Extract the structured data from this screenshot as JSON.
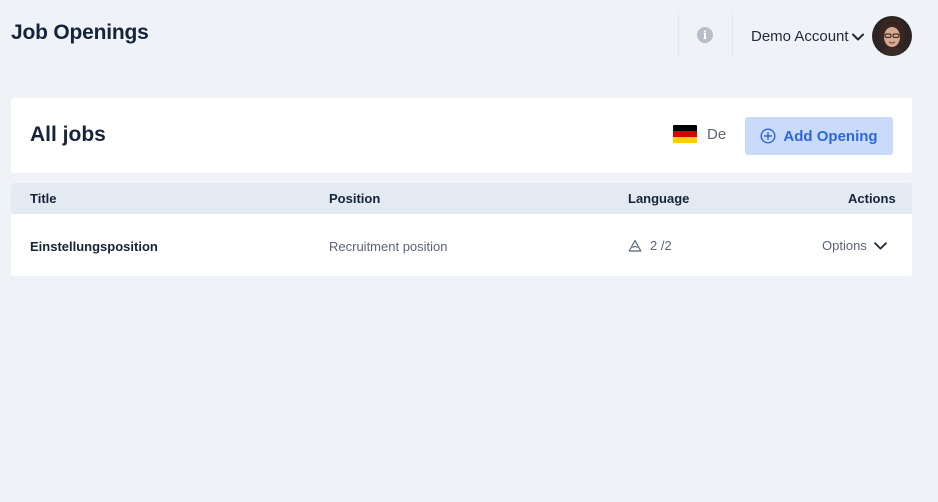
{
  "header": {
    "title": "Job Openings",
    "info_icon": "info-icon",
    "info_glyph": "i",
    "account_name": "Demo Account",
    "account_chevron_icon": "chevron-down-icon",
    "avatar_icon": "avatar"
  },
  "jobs_card": {
    "title": "All jobs",
    "language": {
      "flag_icon": "german-flag-icon",
      "label": "De"
    },
    "add_button": {
      "icon": "plus-circle-icon",
      "label": "Add Opening"
    }
  },
  "table": {
    "columns": [
      "Title",
      "Position",
      "Language",
      "Actions"
    ],
    "rows": [
      {
        "title": "Einstellungsposition",
        "position": "Recruitment position",
        "language_icon": "translate-icon",
        "language_count": "2 /2",
        "actions_label": "Options",
        "actions_icon": "chevron-down-icon"
      }
    ]
  },
  "colors": {
    "background": "#eff3f8",
    "card": "#ffffff",
    "table_header": "#e4eaf2",
    "accent": "#2d67d8",
    "accent_bg": "#c9dafa",
    "text_primary": "#16243a",
    "text_secondary": "#5b6576"
  }
}
